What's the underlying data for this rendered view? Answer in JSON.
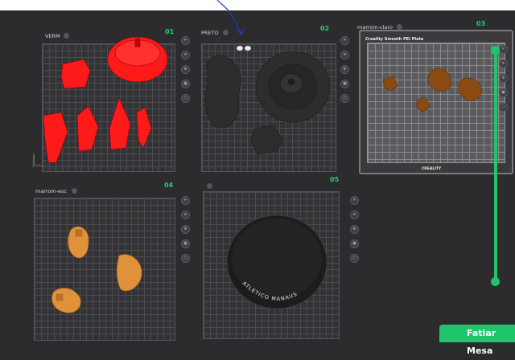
{
  "colors": {
    "accent": "#1fc46b",
    "red_parts": "#ff1a1a",
    "black_parts": "#2d2d2d",
    "brown_parts": "#8b4a12",
    "orange_parts": "#e0923a"
  },
  "plates": [
    {
      "name": "VERM",
      "number": "01"
    },
    {
      "name": "PRETO",
      "number": "02"
    },
    {
      "name": "marrom-claro",
      "number": "03"
    },
    {
      "name": "marrom-esc",
      "number": "04"
    },
    {
      "name": "",
      "number": "05"
    }
  ],
  "bed": {
    "title": "Creality Smooth PEI Plate",
    "brand": "CREALITY"
  },
  "coin_text": "ATLETICO MANAUS",
  "slice_button": "Fatiar Mesa",
  "tool_icons": [
    "close-icon",
    "list-icon",
    "settings-icon",
    "lock-icon",
    "gear-icon"
  ]
}
